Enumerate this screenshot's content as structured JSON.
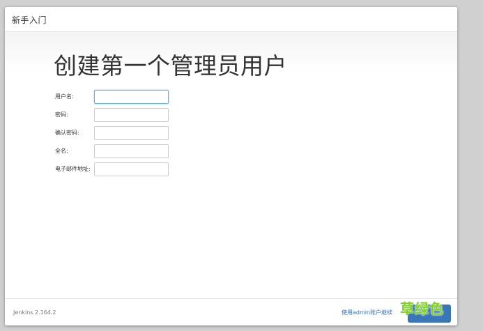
{
  "dialog": {
    "title": "新手入门"
  },
  "main": {
    "heading": "创建第一个管理员用户",
    "fields": [
      {
        "label": "用户名:",
        "value": ""
      },
      {
        "label": "密码:",
        "value": ""
      },
      {
        "label": "确认密码:",
        "value": ""
      },
      {
        "label": "全名:",
        "value": ""
      },
      {
        "label": "电子邮件地址:",
        "value": ""
      }
    ]
  },
  "footer": {
    "version": "Jenkins 2.164.2",
    "continue_as_admin_link": "使用admin账户继续",
    "save_button": ""
  },
  "watermark": {
    "text": "草绿色"
  },
  "colors": {
    "accent": "#3a77b9",
    "link": "#2e72b8",
    "watermark": "#7ed321",
    "backdrop": "#d0d0d0"
  }
}
